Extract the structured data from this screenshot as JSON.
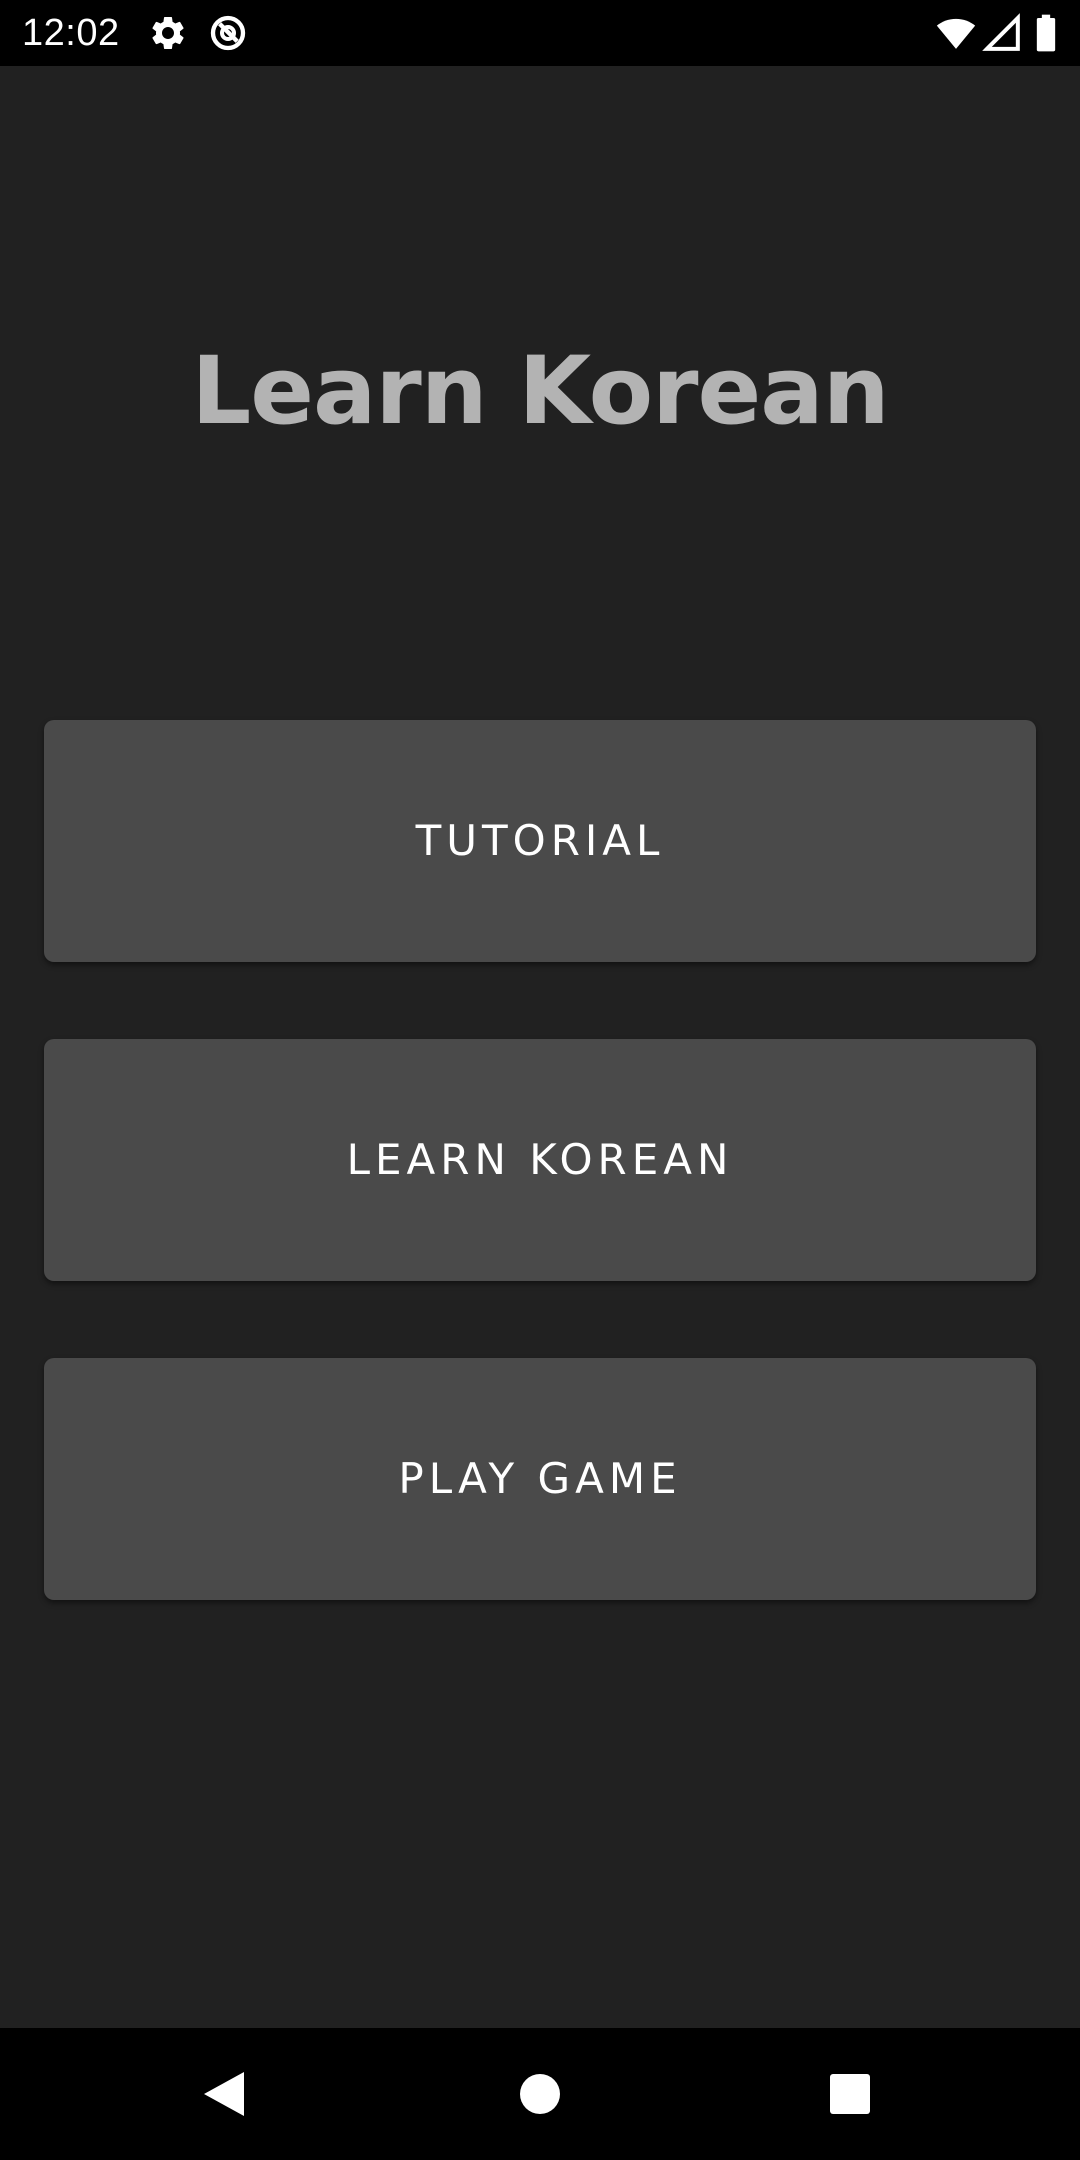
{
  "status_bar": {
    "time": "12:02",
    "icons": [
      "gear-icon",
      "sync-icon",
      "wifi-icon",
      "signal-icon",
      "battery-icon"
    ]
  },
  "app": {
    "title": "Learn Korean",
    "buttons": [
      {
        "label": "TUTORIAL"
      },
      {
        "label": "LEARN KOREAN"
      },
      {
        "label": "PLAY GAME"
      }
    ]
  },
  "nav_bar": {
    "icons": [
      "back-icon",
      "home-icon",
      "recents-icon"
    ]
  },
  "colors": {
    "background": "#212121",
    "button": "#4a4a4a",
    "title": "#b3b3b3",
    "bars": "#000000"
  }
}
